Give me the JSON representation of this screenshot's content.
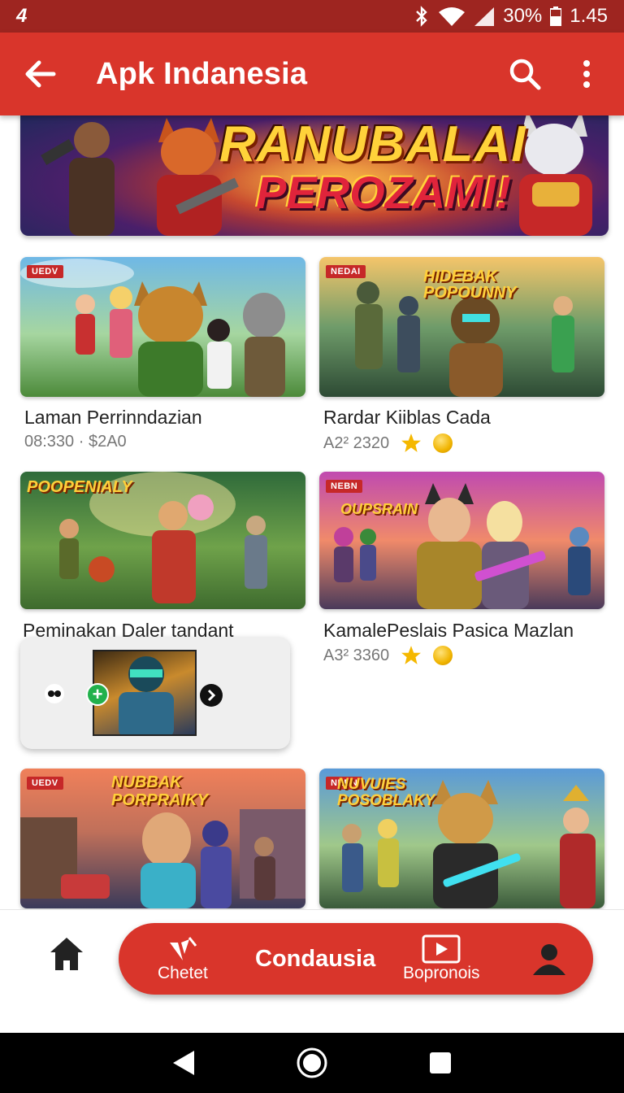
{
  "status_bar": {
    "left_glyph": "4",
    "battery": "30%",
    "time": "1.45"
  },
  "app_bar": {
    "title": "Apk Indanesia",
    "back_icon": "arrow-left-icon",
    "search_icon": "search-icon",
    "menu_icon": "more-vert-icon"
  },
  "banner": {
    "line1": "RANUBALAI",
    "line2": "PEROZAMI!"
  },
  "cards": [
    {
      "badge": "UEDV",
      "title": "Laman Perrinndazian",
      "meta": "08:330 · $2A0",
      "art_text": ""
    },
    {
      "badge": "NEDAI",
      "title": "Rardar Kiiblas Cada",
      "meta": "A2² 2320",
      "art_text": "HIDEBAK POPOUNNY"
    },
    {
      "badge": "",
      "title": "Peminakan Daler tandant",
      "meta": "",
      "art_text": "POOPENIALY"
    },
    {
      "badge": "NEBN",
      "title": "KamalePeslais Pasica Mazlan",
      "meta": "A3² 3360",
      "art_text": "OUPSRAIN"
    },
    {
      "badge": "UEDV",
      "title": "",
      "meta": "",
      "art_text": "NUBBAK PORPRAIKY"
    },
    {
      "badge": "NEBN",
      "title": "",
      "meta": "",
      "art_text": "NUVUIES POSOBLAKY"
    }
  ],
  "bottom_nav": {
    "home_icon": "home-icon",
    "item1_label": "Chetet",
    "center_label": "Condausia",
    "item3_label": "Bopronois",
    "profile_icon": "person-icon"
  },
  "colors": {
    "primary": "#d9352b",
    "status": "#9e2520",
    "badge": "#c62828"
  }
}
